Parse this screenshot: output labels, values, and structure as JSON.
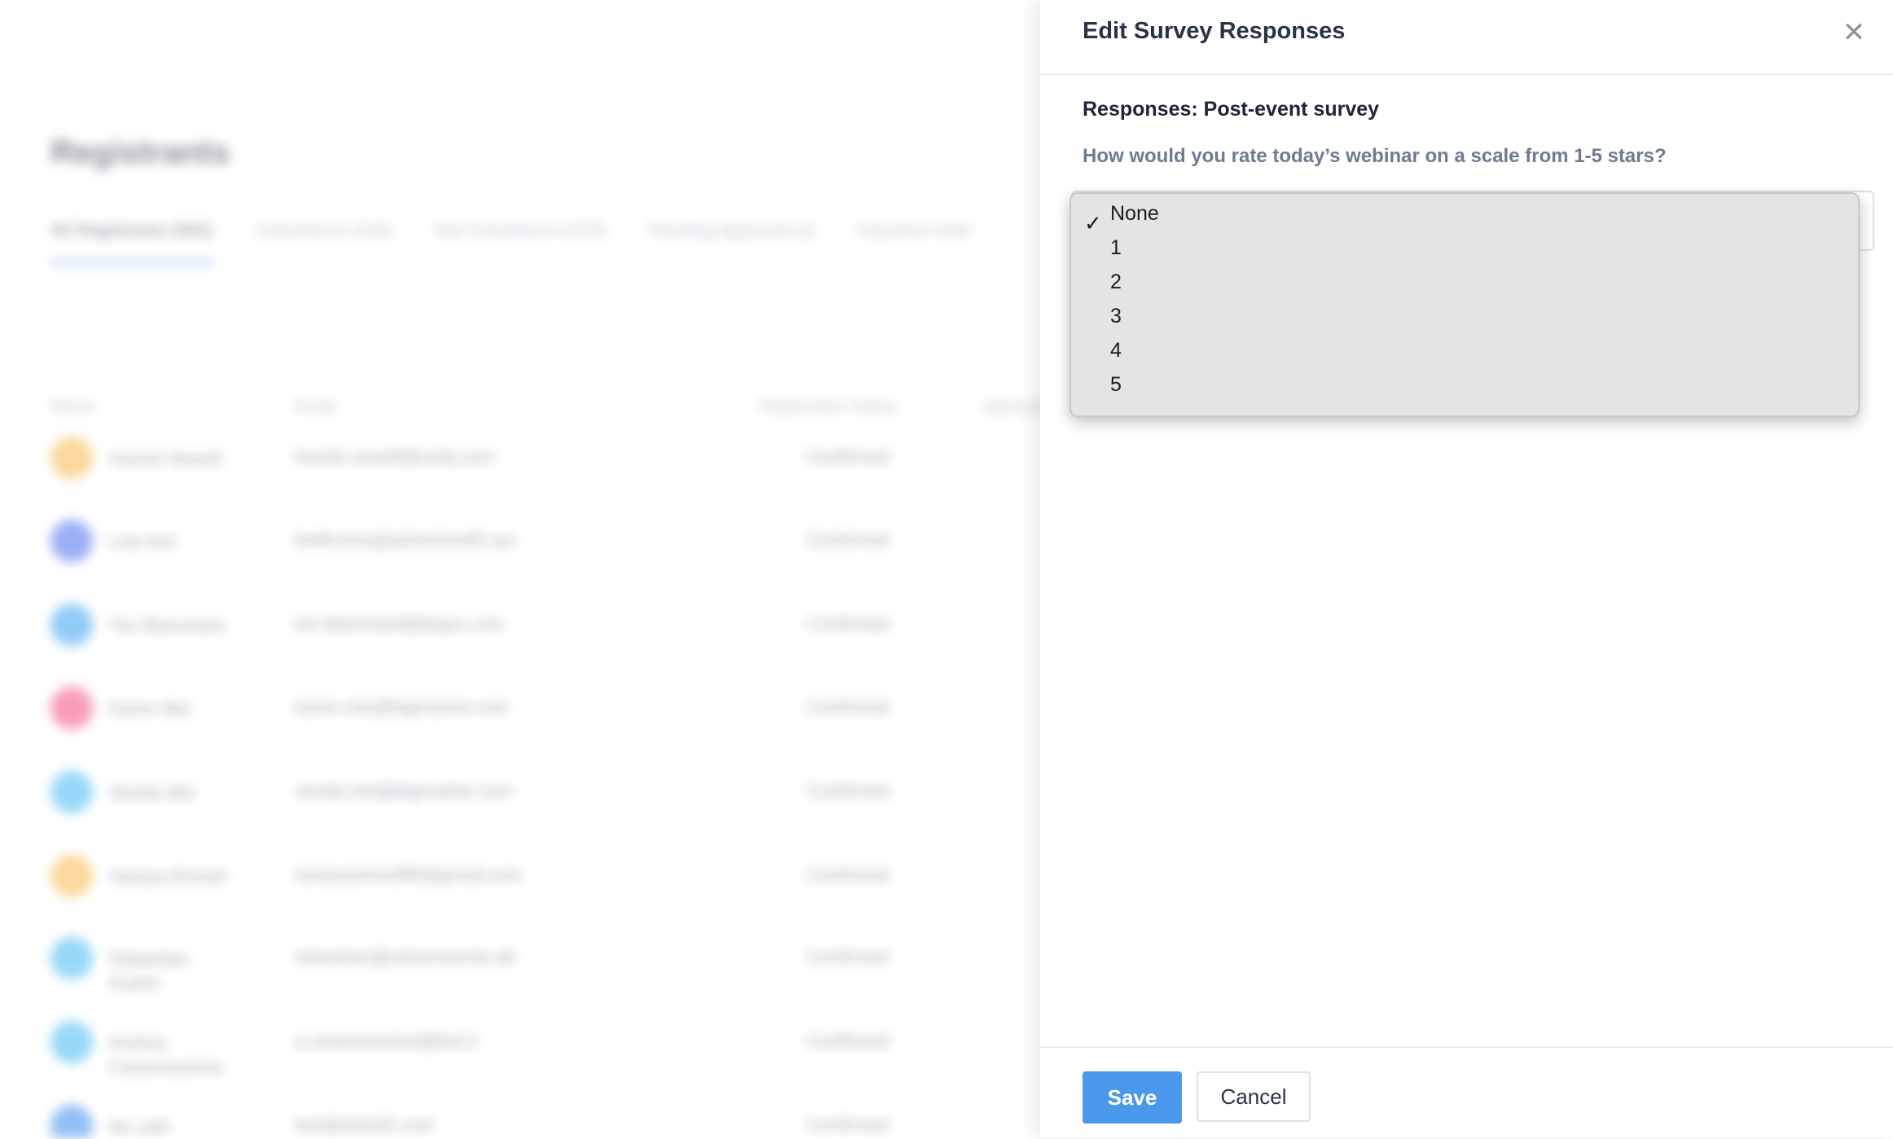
{
  "background": {
    "title": "Registrants",
    "tabs": [
      {
        "label": "All Registrants (583)"
      },
      {
        "label": "Checked In (318)"
      },
      {
        "label": "Not Checked In (275)"
      },
      {
        "label": "Pending Approval (2)"
      },
      {
        "label": "Payment Hold"
      }
    ],
    "columns": {
      "name": "Name",
      "email": "Email",
      "status": "Registration Status",
      "approval": "Approval"
    },
    "rows": [
      {
        "name": "Harriet Newell",
        "email": "harriet.newell@unity.com",
        "status": "Confirmed",
        "color": "#f8b84a"
      },
      {
        "name": "Lisa test",
        "email": "bellkroma@advertmo85.xyz",
        "status": "Confirmed",
        "color": "#4a6ef0"
      },
      {
        "name": "Tori Blanchard",
        "email": "tori.blanchard@tegus.com",
        "status": "Confirmed",
        "color": "#3aa0f0"
      },
      {
        "name": "Karen Mei",
        "email": "karen.mei@bigmarker.com",
        "status": "Confirmed",
        "color": "#f24d7e"
      },
      {
        "name": "Senda Mei",
        "email": "senda.mei@bigmarker.com",
        "status": "Confirmed",
        "color": "#42b8f2"
      },
      {
        "name": "Haniya Ahmed",
        "email": "haniyaahmed96@gmail.com",
        "status": "Confirmed",
        "color": "#f8b84a"
      },
      {
        "name": "Sebastian Kuehn",
        "email": "sebastian@citizenscircle.de",
        "status": "Confirmed",
        "color": "#42b8f2"
      },
      {
        "name": "Andrea Casamassima",
        "email": "a.casamassima@ted.it",
        "status": "Confirmed",
        "color": "#42b8f2"
      },
      {
        "name": "leo yaki",
        "email": "test@adroll2.com",
        "status": "Confirmed",
        "color": "#3a8af0"
      }
    ]
  },
  "panel": {
    "title": "Edit Survey Responses",
    "close_icon": "close-icon",
    "section_title": "Responses: Post-event survey",
    "question": "How would you rate today’s webinar on a scale from 1-5 stars?",
    "dropdown": {
      "selected": "None",
      "options": [
        "None",
        "1",
        "2",
        "3",
        "4",
        "5"
      ]
    },
    "footer": {
      "save_label": "Save",
      "cancel_label": "Cancel"
    },
    "colors": {
      "primary": "#4a97ec"
    }
  }
}
